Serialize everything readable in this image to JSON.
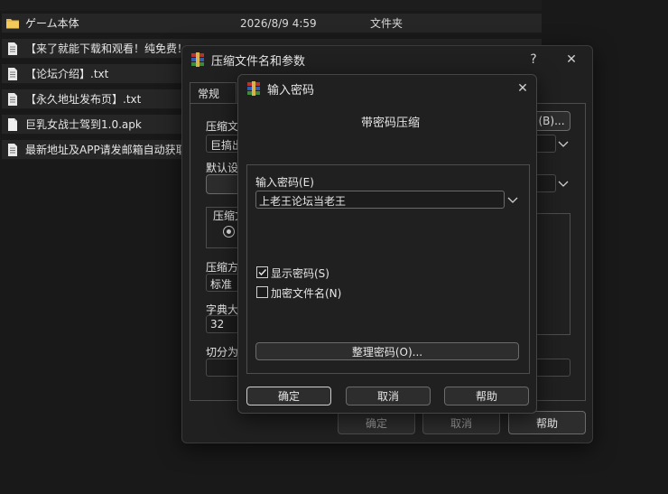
{
  "files": [
    {
      "name": "ゲーム本体",
      "date": "2026/8/9 4:59",
      "type": "文件夹",
      "icon": "folder-icon"
    },
    {
      "name": "【来了就能下载和观看！纯免费！",
      "date": "",
      "type": "",
      "icon": "text-file-icon"
    },
    {
      "name": "【论坛介绍】.txt",
      "date": "",
      "type": "",
      "icon": "text-file-icon"
    },
    {
      "name": "【永久地址发布页】.txt",
      "date": "",
      "type": "",
      "icon": "text-file-icon"
    },
    {
      "name": "巨乳女战士驾到1.0.apk",
      "date": "",
      "type": "",
      "icon": "file-icon"
    },
    {
      "name": "最新地址及APP请发邮箱自动获取",
      "date": "",
      "type": "",
      "icon": "text-file-icon"
    }
  ],
  "archive_dialog": {
    "title": "压缩文件名和参数",
    "help_label": "?",
    "tab_general": "常规",
    "archive_name_label": "压缩文",
    "browse_label": "(B)...",
    "archive_name_value": "巨搞出",
    "default_profile_label": "默认设",
    "format_group_label": "压缩文",
    "method_label": "压缩方",
    "method_value": "标准",
    "dict_label": "字典大",
    "dict_value": "32",
    "split_label": "切分为",
    "ok_label": "确定",
    "cancel_label": "取消",
    "help_button_label": "帮助"
  },
  "password_dialog": {
    "title": "输入密码",
    "heading": "带密码压缩",
    "password_label": "输入密码(E)",
    "password_value": "上老王论坛当老王",
    "show_password_label": "显示密码(S)",
    "show_password_checked": true,
    "encrypt_names_label": "加密文件名(N)",
    "encrypt_names_checked": false,
    "organize_label": "整理密码(O)...",
    "ok_label": "确定",
    "cancel_label": "取消",
    "help_label": "帮助"
  },
  "colors": {
    "folder": "#e8b84a",
    "winrar_red": "#b5352c",
    "winrar_blue": "#2f5fb3"
  }
}
